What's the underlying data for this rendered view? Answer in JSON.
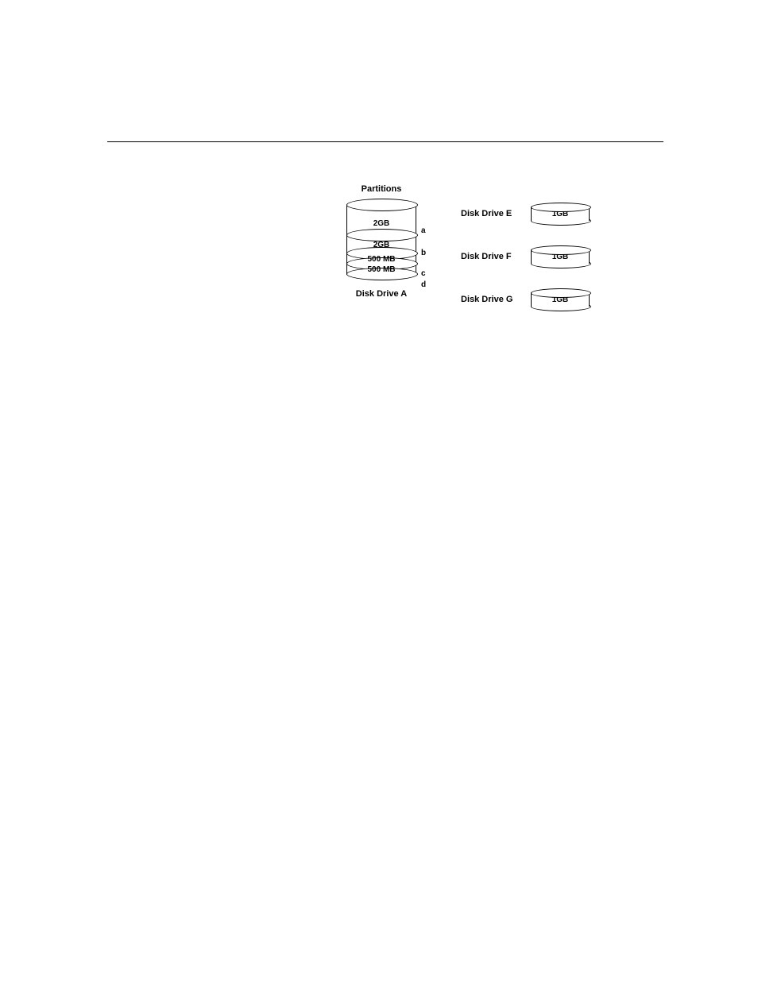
{
  "partitions_heading": "Partitions",
  "drive_a": {
    "name": "Disk Drive A",
    "slices": [
      {
        "letter": "a",
        "size": "2GB",
        "h": 38
      },
      {
        "letter": "b",
        "size": "2GB",
        "h": 30
      },
      {
        "letter": "c",
        "size": "500 MB",
        "h": 18
      },
      {
        "letter": "d",
        "size": "500 MB",
        "h": 18
      }
    ]
  },
  "small_drives": [
    {
      "name": "Disk Drive E",
      "size": "1GB"
    },
    {
      "name": "Disk Drive F",
      "size": "1GB"
    },
    {
      "name": "Disk Drive G",
      "size": "1GB"
    }
  ],
  "letter_offsets": [
    30,
    58,
    84,
    98
  ]
}
